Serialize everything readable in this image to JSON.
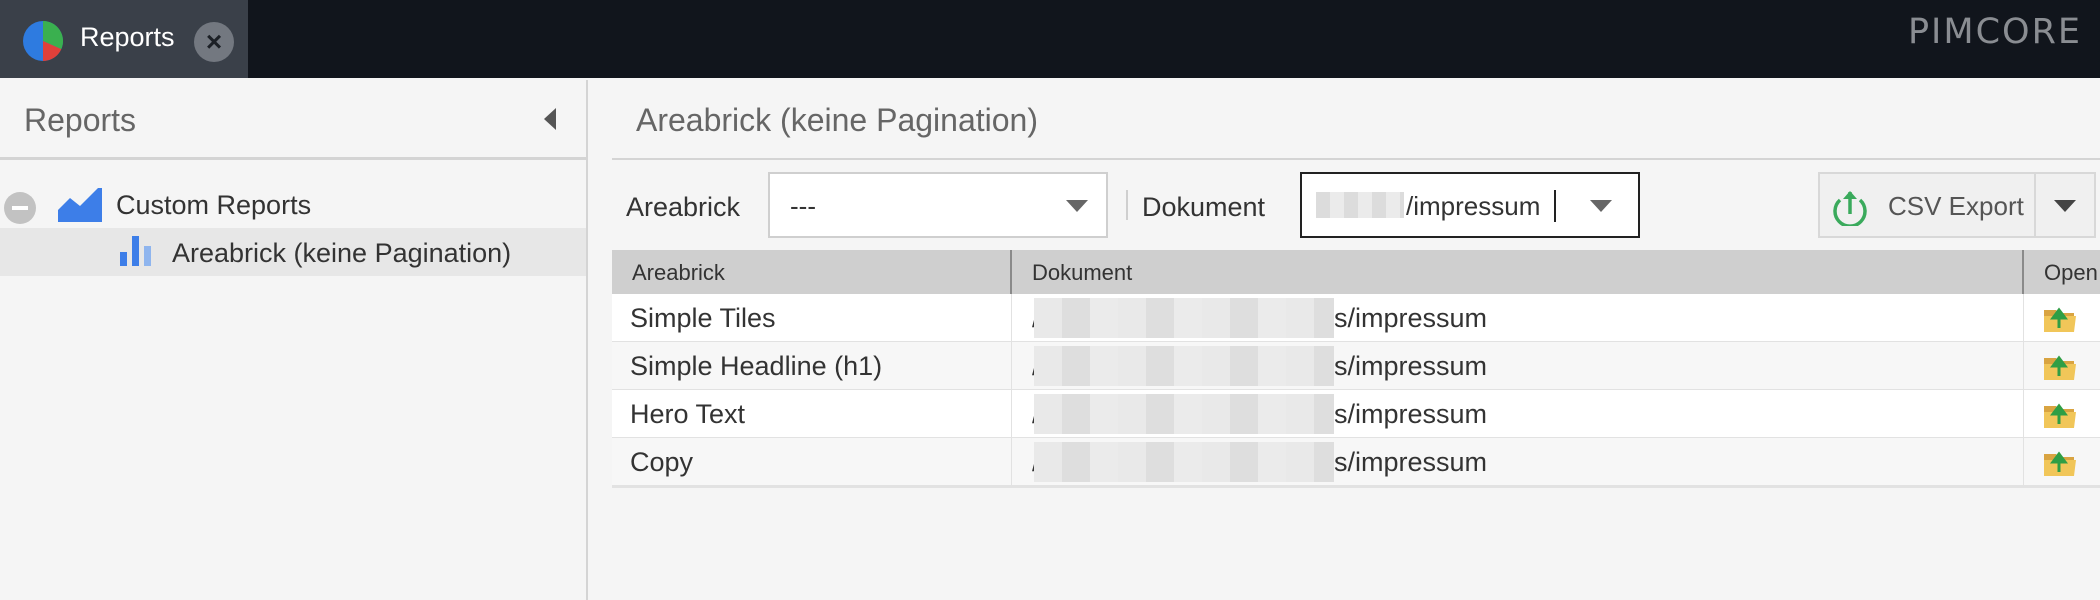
{
  "app": {
    "tab": {
      "label": "Reports",
      "icon": "pie-chart-icon"
    },
    "brand": "PIMCORE"
  },
  "left_panel": {
    "title": "Reports",
    "tree": [
      {
        "label": "Custom Reports",
        "icon": "area-chart-icon",
        "expanded": true
      },
      {
        "label": "Areabrick (keine Pagination)",
        "icon": "bar-chart-icon",
        "selected": true
      }
    ]
  },
  "report": {
    "title": "Areabrick (keine Pagination)",
    "filters": {
      "areabrick_label": "Areabrick",
      "areabrick_value": "---",
      "dokument_label": "Dokument",
      "dokument_value": "/impressum"
    },
    "export_button": "CSV Export",
    "columns": [
      "Areabrick",
      "Dokument",
      "Open"
    ],
    "rows": [
      {
        "areabrick": "Simple Tiles",
        "dokument_prefix": "/",
        "dokument_suffix": "s/impressum"
      },
      {
        "areabrick": "Simple Headline (h1)",
        "dokument_prefix": "/",
        "dokument_suffix": "s/impressum"
      },
      {
        "areabrick": "Hero Text",
        "dokument_prefix": "/",
        "dokument_suffix": "s/impressum"
      },
      {
        "areabrick": "Copy",
        "dokument_prefix": "/",
        "dokument_suffix": "s/impressum"
      }
    ]
  },
  "colors": {
    "topbar": "#11151c",
    "tab_active": "#3a4049",
    "accent_blue": "#3d7ee8",
    "export_green": "#3aaa5c"
  }
}
